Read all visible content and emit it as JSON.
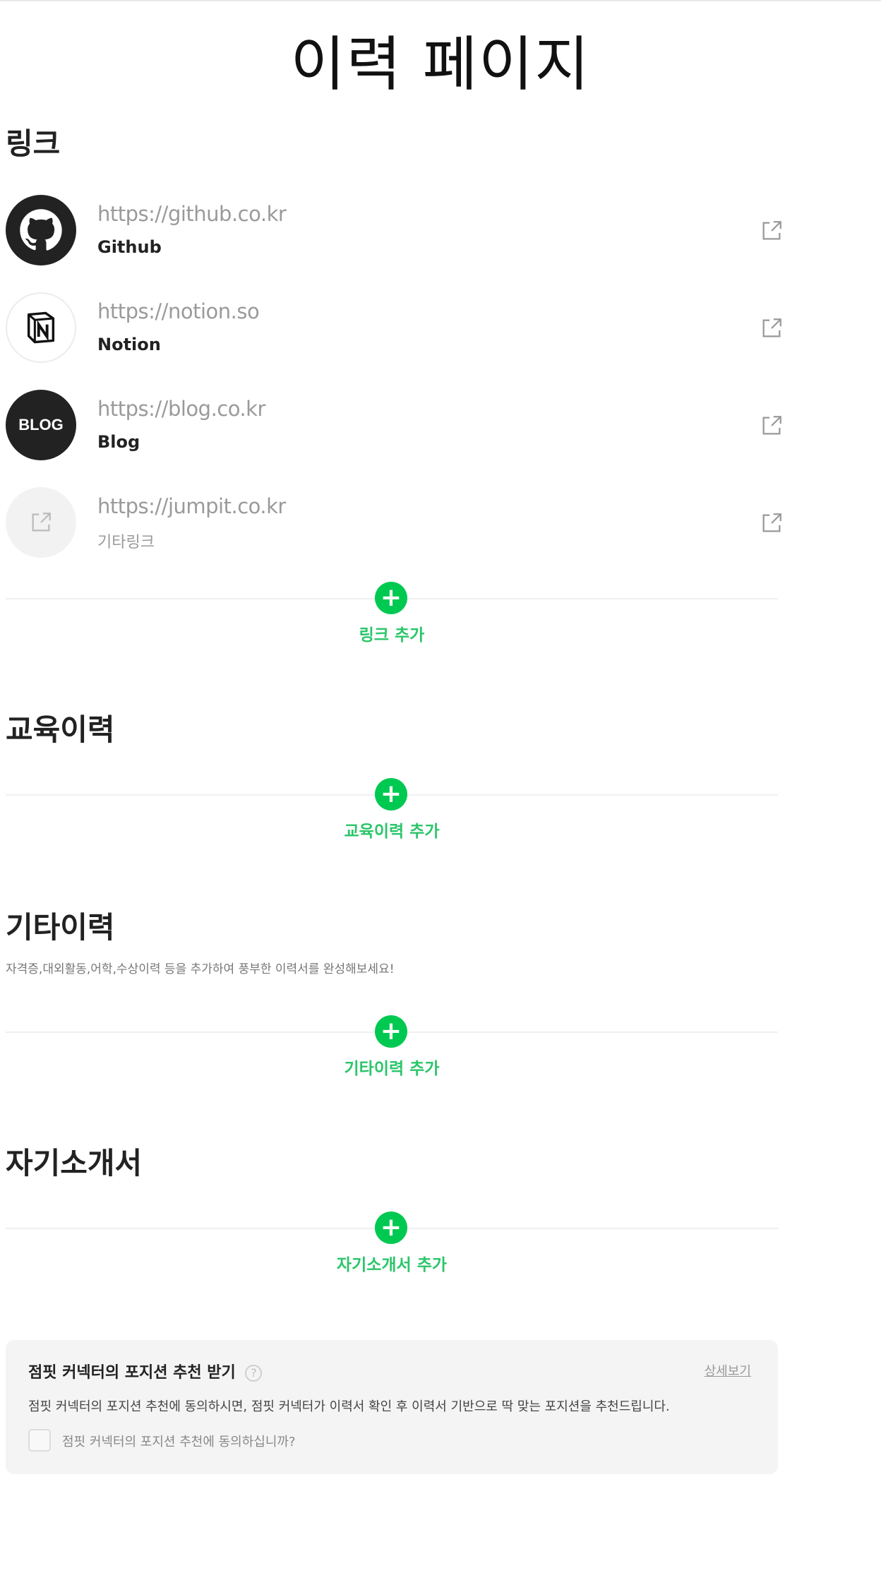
{
  "page": {
    "title": "이력 페이지"
  },
  "links": {
    "title": "링크",
    "items": [
      {
        "url": "https://github.co.kr",
        "label": "Github",
        "icon": "github-icon"
      },
      {
        "url": "https://notion.so",
        "label": "Notion",
        "icon": "notion-icon"
      },
      {
        "url": "https://blog.co.kr",
        "label": "Blog",
        "icon": "blog-icon",
        "icon_text": "BLOG"
      },
      {
        "url": "https://jumpit.co.kr",
        "label": "기타링크",
        "icon": "external-link-icon"
      }
    ],
    "add_label": "링크 추가"
  },
  "education": {
    "title": "교육이력",
    "add_label": "교육이력 추가"
  },
  "other": {
    "title": "기타이력",
    "description": "자격증,대외활동,어학,수상이력 등을 추가하여 풍부한 이력서를 완성해보세요!",
    "add_label": "기타이력 추가"
  },
  "intro": {
    "title": "자기소개서",
    "add_label": "자기소개서 추가"
  },
  "recommendation": {
    "title": "점핏 커넥터의 포지션 추천 받기",
    "help": "?",
    "detail_link": "상세보기",
    "description": "점핏 커넥터의 포지션 추천에 동의하시면, 점핏 커넥터가 이력서 확인 후 이력서 기반으로 딱 맞는 포지션을 추천드립니다.",
    "checkbox_label": "점핏 커넥터의 포지션 추천에 동의하십니까?"
  },
  "colors": {
    "accent": "#00c951",
    "accent_text": "#2bc56a",
    "box_bg": "#f4f4f4"
  }
}
